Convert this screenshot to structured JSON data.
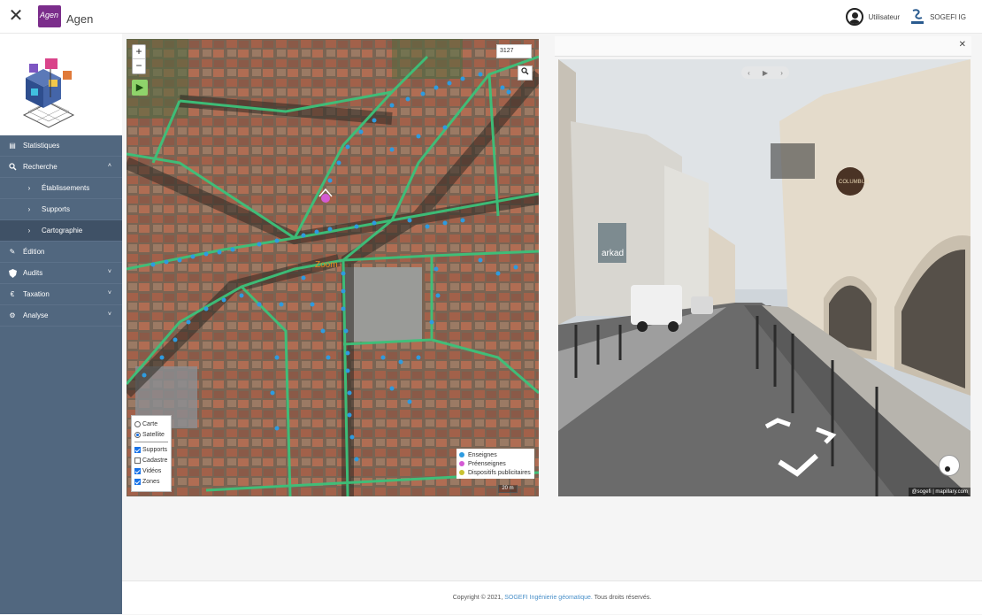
{
  "header": {
    "app_title": "Agen",
    "logo_text": "Agen",
    "user_label": "Utilisateur",
    "org_label": "SOGEFI IG"
  },
  "sidebar": {
    "items": [
      {
        "label": "Statistiques",
        "icon": "chart-icon"
      },
      {
        "label": "Recherche",
        "icon": "search-icon"
      },
      {
        "label": "Établissements",
        "icon": "chevron-right-icon"
      },
      {
        "label": "Supports",
        "icon": "chevron-right-icon"
      },
      {
        "label": "Cartographie",
        "icon": "chevron-right-icon"
      },
      {
        "label": "Édition",
        "icon": "pencil-icon"
      },
      {
        "label": "Audits",
        "icon": "shield-icon"
      },
      {
        "label": "Taxation",
        "icon": "euro-icon"
      },
      {
        "label": "Analyse",
        "icon": "gear-icon"
      }
    ]
  },
  "map": {
    "coord_value": "3127",
    "place_label": "Zoom",
    "basemap": {
      "options": [
        "Carte",
        "Satellite"
      ],
      "selected": "Satellite"
    },
    "layers": [
      {
        "label": "Supports",
        "checked": true
      },
      {
        "label": "Cadastre",
        "checked": false
      },
      {
        "label": "Vidéos",
        "checked": true
      },
      {
        "label": "Zones",
        "checked": true
      }
    ],
    "legend": [
      {
        "label": "Enseignes",
        "color": "#2e9be0"
      },
      {
        "label": "Préenseignes",
        "color": "#d45ad4"
      },
      {
        "label": "Dispositifs publicitaires",
        "color": "#c9c232"
      }
    ],
    "scale_label": "20 m"
  },
  "streetview": {
    "shop_sign": "arkad",
    "cafe_sign": "COLUMBUS",
    "attribution": "@sogefi | mapillary.com"
  },
  "footer": {
    "prefix": "Copyright © 2021,",
    "link": "SOGEFI Ingénierie géomatique.",
    "suffix": "Tous droits réservés."
  }
}
